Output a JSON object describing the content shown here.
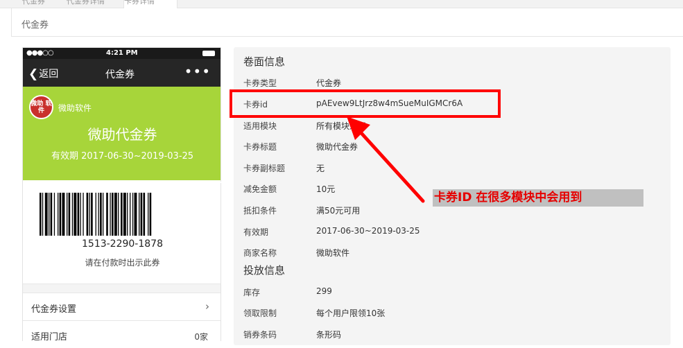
{
  "top_tabs": [
    "代金券",
    "代金券详情",
    "卡券详情"
  ],
  "section_title": "代金券",
  "phone": {
    "status_time": "4:21 PM",
    "back_label": "返回",
    "nav_title": "代金券",
    "more": "•••",
    "brand_logo_text": "微助 软件",
    "brand_name": "微助软件",
    "coupon_title": "微助代金券",
    "validity": "有效期 2017-06-30~2019-03-25",
    "barcode_number": "1513-2290-1878",
    "barcode_tip": "请在付款时出示此券",
    "menu": [
      {
        "label": "代金券设置",
        "value": "",
        "arrow": "›"
      },
      {
        "label": "适用门店",
        "value": "0家",
        "arrow": ""
      }
    ],
    "accent": "#a7d53a"
  },
  "panel": {
    "face_heading": "卷面信息",
    "face_rows": [
      {
        "label": "卡券类型",
        "value": "代金券"
      },
      {
        "label": "卡券id",
        "value": "pAEvew9LtJrz8w4mSueMuIGMCr6A"
      },
      {
        "label": "适用模块",
        "value": "所有模块适用"
      },
      {
        "label": "卡券标题",
        "value": "微助代金券"
      },
      {
        "label": "卡券副标题",
        "value": "无"
      },
      {
        "label": "减免金额",
        "value": "10元"
      },
      {
        "label": "抵扣条件",
        "value": "满50元可用"
      },
      {
        "label": "有效期",
        "value": "2017-06-30~2019-03-25"
      },
      {
        "label": "商家名称",
        "value": "微助软件"
      }
    ],
    "dist_heading": "投放信息",
    "dist_rows": [
      {
        "label": "库存",
        "value": "299"
      },
      {
        "label": "领取限制",
        "value": "每个用户限领10张"
      },
      {
        "label": "销券条码",
        "value": "条形码"
      }
    ]
  },
  "annotation_text": "卡券ID 在很多模块中会用到",
  "annotation_color": "#e60000"
}
